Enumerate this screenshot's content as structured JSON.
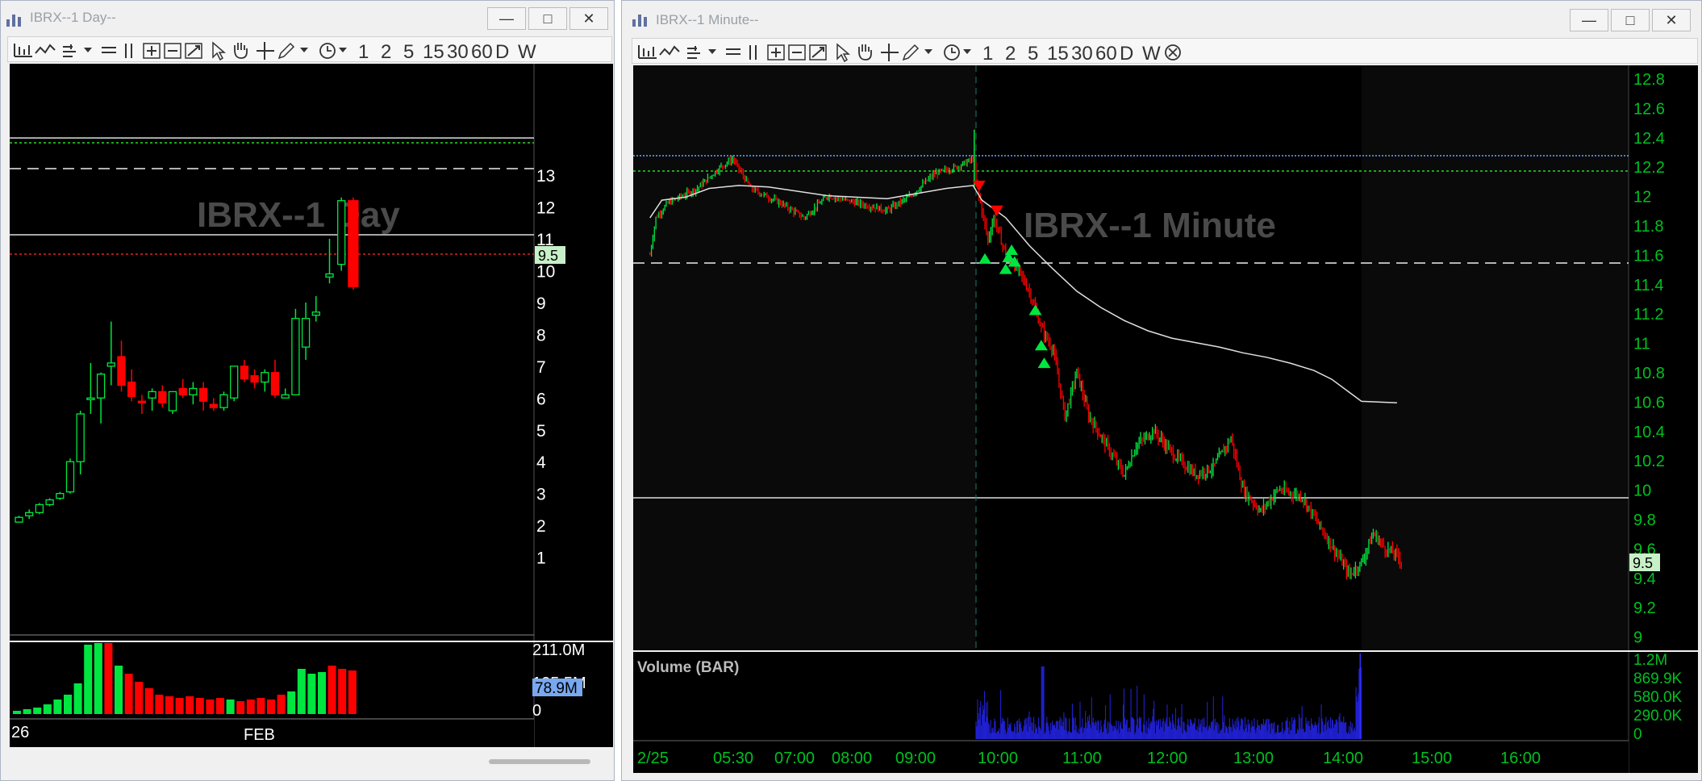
{
  "left_window": {
    "title": "IBRX--1 Day--",
    "watermark": "IBRX--1 Day",
    "price_axis": [
      "13",
      "12",
      "11",
      "10",
      "9",
      "8",
      "7",
      "6",
      "5",
      "4",
      "3",
      "2",
      "1"
    ],
    "last_price_label": "9.5",
    "volume_axis": [
      "211.0M",
      "105.5M",
      "0"
    ],
    "last_volume_label": "78.9M",
    "date_axis": [
      "26",
      "FEB"
    ],
    "toolbar_intervals": [
      "1",
      "2",
      "5",
      "15",
      "30",
      "60",
      "D",
      "W"
    ]
  },
  "right_window": {
    "title": "IBRX--1 Minute--",
    "watermark": "IBRX--1 Minute",
    "price_axis": [
      "12.8",
      "12.6",
      "12.4",
      "12.2",
      "12",
      "11.8",
      "11.6",
      "11.4",
      "11.2",
      "11",
      "10.8",
      "10.6",
      "10.4",
      "10.2",
      "10",
      "9.8",
      "9.6",
      "9.4",
      "9.2",
      "9"
    ],
    "last_price_label": "9.5",
    "volume_title": "Volume (BAR)",
    "volume_axis": [
      "1.2M",
      "869.9K",
      "580.0K",
      "290.0K",
      "0"
    ],
    "time_axis": [
      "2/25",
      "05:30",
      "07:00",
      "08:00",
      "09:00",
      "10:00",
      "11:00",
      "12:00",
      "13:00",
      "14:00",
      "15:00",
      "16:00"
    ],
    "toolbar_intervals": [
      "1",
      "2",
      "5",
      "15",
      "30",
      "60",
      "D",
      "W"
    ]
  },
  "colors": {
    "up": "#00e640",
    "down": "#ff0000",
    "axis_text": "#00c020",
    "volume_bar": "#2020d0",
    "ma_line": "#e0e0e0",
    "price_tag": "#c8f0c8",
    "volume_tag": "#78a8f0"
  },
  "icons": [
    "bar-chart-icon",
    "line-chart-icon",
    "step-chart-icon",
    "dropdown-icon",
    "horizontal-line-icon",
    "vertical-line-icon",
    "zoom-in-icon",
    "zoom-out-icon",
    "zoom-fit-icon",
    "cursor-icon",
    "hand-icon",
    "crosshair-icon",
    "pencil-icon",
    "clock-icon",
    "close-circle-icon"
  ]
}
